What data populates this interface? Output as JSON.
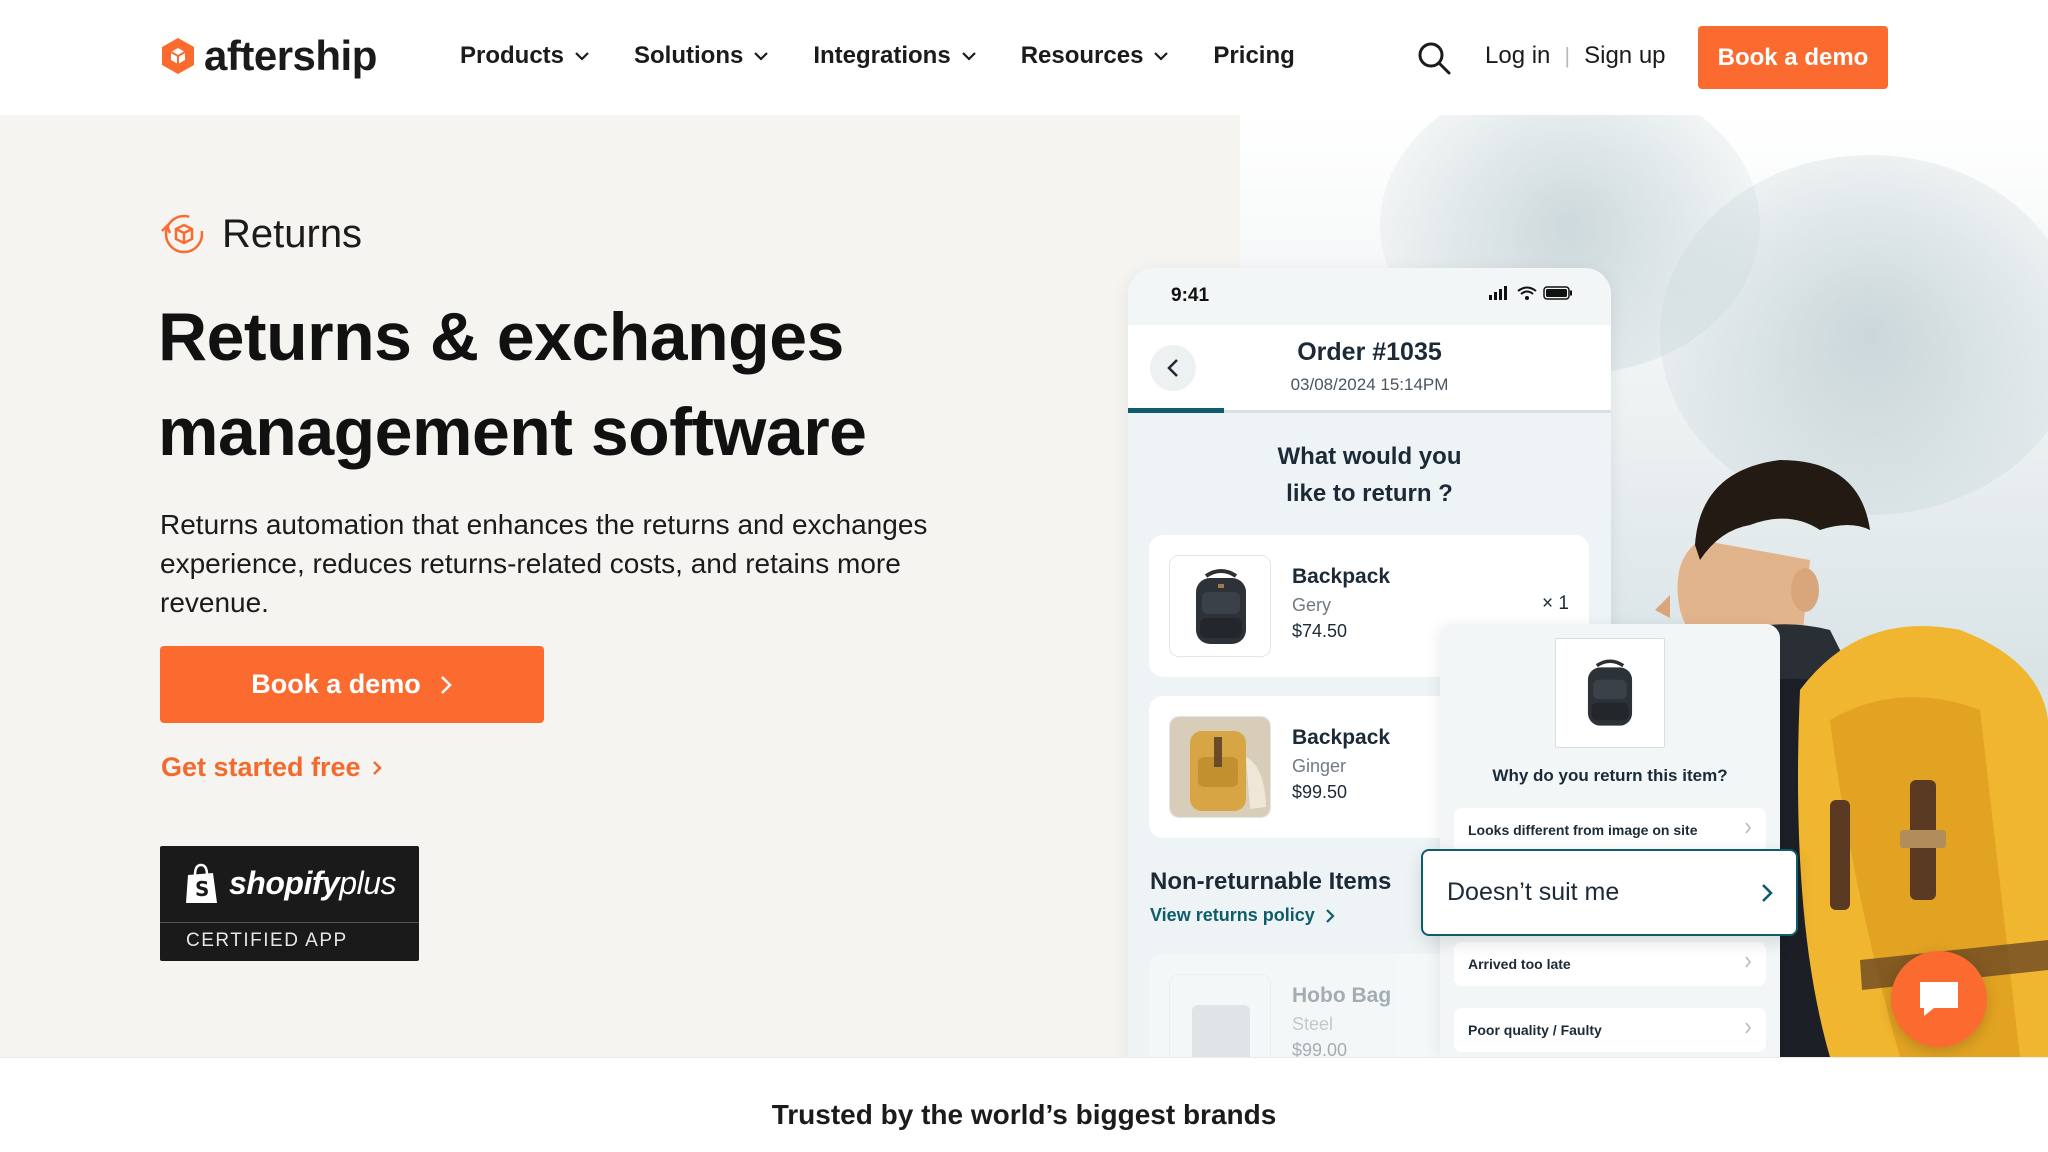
{
  "brand": {
    "name": "aftership",
    "accent": "#fb6b30",
    "teal": "#0f5c6b"
  },
  "nav": {
    "items": [
      {
        "label": "Products",
        "has_dropdown": true
      },
      {
        "label": "Solutions",
        "has_dropdown": true
      },
      {
        "label": "Integrations",
        "has_dropdown": true
      },
      {
        "label": "Resources",
        "has_dropdown": true
      },
      {
        "label": "Pricing",
        "has_dropdown": false
      }
    ],
    "login": "Log in",
    "signup": "Sign up",
    "cta": "Book a demo",
    "search_icon": "search-icon"
  },
  "hero": {
    "product": "Returns",
    "title_line1": "Returns & exchanges",
    "title_line2": "management software",
    "subtitle": "Returns automation that enhances the returns and exchanges experience, reduces returns-related costs, and retains more revenue.",
    "cta_primary": "Book a demo",
    "cta_secondary": "Get started free",
    "badge": {
      "wordmark_bold": "shopify",
      "wordmark_light": "plus",
      "caption": "CERTIFIED APP"
    }
  },
  "phone": {
    "time": "9:41",
    "order_title": "Order #1035",
    "order_date": "03/08/2024 15:14PM",
    "question_line1": "What would you",
    "question_line2": "like to return ?",
    "items": [
      {
        "name": "Backpack",
        "variant": "Gery",
        "price": "$74.50",
        "qty": "× 1"
      },
      {
        "name": "Backpack",
        "variant": "Ginger",
        "price": "$99.50"
      }
    ],
    "non_returnable_title": "Non-returnable Items",
    "policy_link": "View returns policy",
    "non_returnable_items": [
      {
        "name": "Hobo Bag",
        "variant": "Steel",
        "price": "$99.00"
      }
    ]
  },
  "reason_panel": {
    "question": "Why do you return this item?",
    "options": [
      "Looks different from image on site",
      "Arrived too late",
      "Poor quality / Faulty"
    ],
    "selected": "Doesn’t suit me"
  },
  "trusted": "Trusted by the world’s biggest brands"
}
